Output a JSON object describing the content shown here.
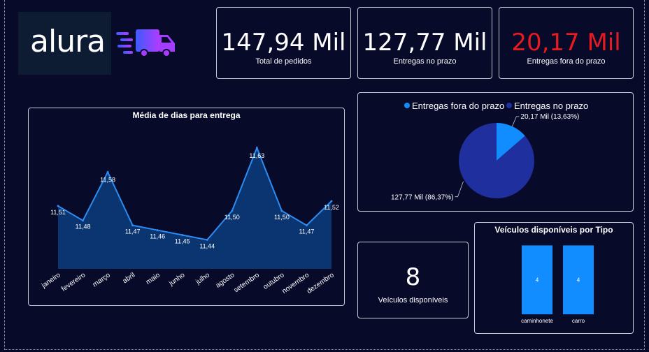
{
  "logo": {
    "text": "alura"
  },
  "kpis": {
    "total_pedidos": {
      "value": "147,94 Mil",
      "label": "Total de pedidos"
    },
    "no_prazo": {
      "value": "127,77 Mil",
      "label": "Entregas no prazo"
    },
    "fora_prazo": {
      "value": "20,17 Mil",
      "label": "Entregas fora do prazo",
      "color": "#e8191f"
    },
    "veiculos": {
      "value": "8",
      "label": "Veículos disponíveis"
    }
  },
  "colors": {
    "background": "#080a2a",
    "line": "#2b8cf2",
    "area": "#0b3a78",
    "pie_fora": "#118dff",
    "pie_prazo": "#1f2f9e",
    "bars": "#118dff"
  },
  "chart_data": [
    {
      "type": "area",
      "title": "Média de dias para entrega",
      "categories": [
        "janeiro",
        "fevereiro",
        "março",
        "abril",
        "maio",
        "junho",
        "julho",
        "agosto",
        "setembro",
        "outubro",
        "novembro",
        "dezembro"
      ],
      "values": [
        11.51,
        11.48,
        11.58,
        11.47,
        11.46,
        11.45,
        11.44,
        11.5,
        11.63,
        11.5,
        11.47,
        11.52
      ],
      "data_labels": [
        "11,51",
        "11,48",
        "11,58",
        "11,47",
        "11,46",
        "11,45",
        "11,44",
        "11,50",
        "11,63",
        "11,50",
        "11,47",
        "11,52"
      ],
      "ylim": [
        11.38,
        11.66
      ],
      "grid": false
    },
    {
      "type": "pie",
      "legend": [
        "Entregas fora do prazo",
        "Entregas no prazo"
      ],
      "legend_position": "top",
      "slices": [
        {
          "name": "Entregas fora do prazo",
          "value": 20.17,
          "label": "20,17 Mil (13,63%)"
        },
        {
          "name": "Entregas no prazo",
          "value": 127.77,
          "label": "127,77 Mil (86,37%)"
        }
      ]
    },
    {
      "type": "bar",
      "title": "Veículos disponíveis por Tipo",
      "categories": [
        "caminhonete",
        "carro"
      ],
      "values": [
        4,
        4
      ],
      "data_labels": [
        "4",
        "4"
      ],
      "ylim": [
        0,
        4.3
      ]
    }
  ]
}
